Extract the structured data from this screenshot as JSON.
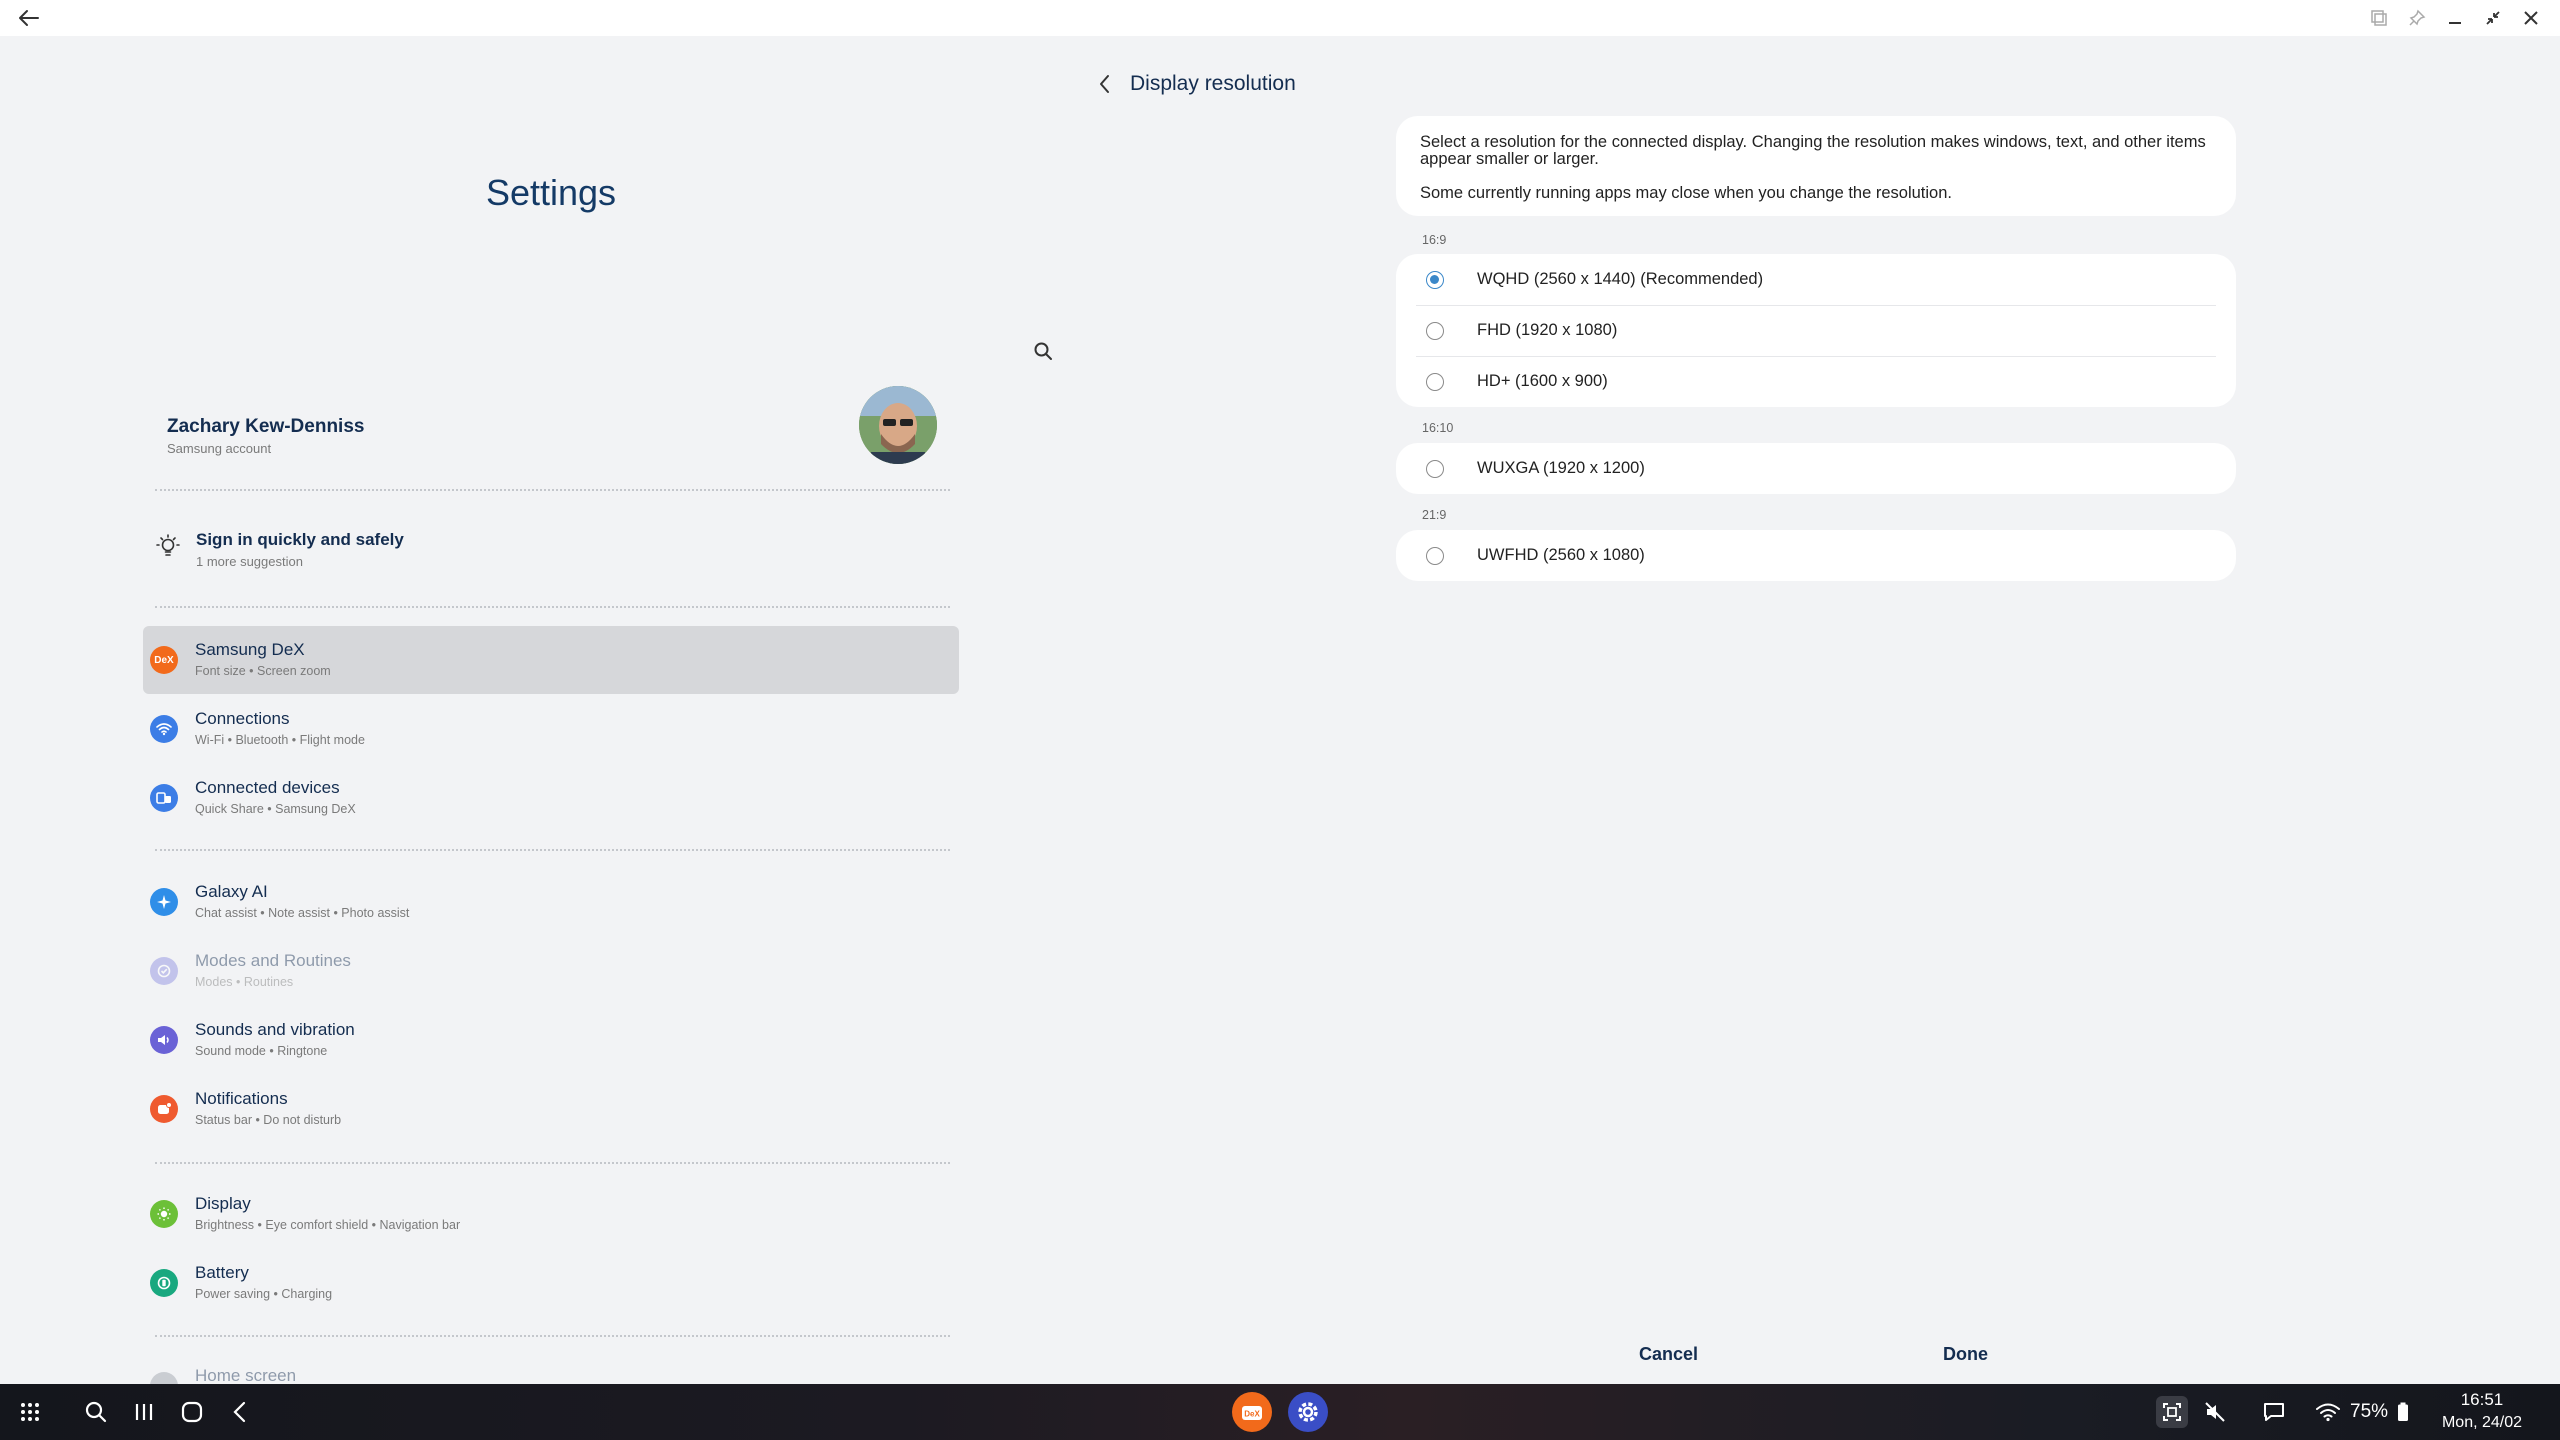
{
  "settings": {
    "title": "Settings",
    "account": {
      "name": "Zachary Kew-Denniss",
      "sub": "Samsung account"
    },
    "suggestion": {
      "title": "Sign in quickly and safely",
      "sub": "1 more suggestion"
    },
    "items": [
      {
        "title": "Samsung DeX",
        "sub": "Font size  •  Screen zoom",
        "icon_label": "DeX",
        "color": "#f26a1b"
      },
      {
        "title": "Connections",
        "sub": "Wi-Fi  •  Bluetooth  •  Flight mode",
        "color": "#3c7de6"
      },
      {
        "title": "Connected devices",
        "sub": "Quick Share  •  Samsung DeX",
        "color": "#3c7de6"
      },
      {
        "title": "Galaxy AI",
        "sub": "Chat assist  •  Note assist  •  Photo assist",
        "color": "#2f8ee8"
      },
      {
        "title": "Modes and Routines",
        "sub": "Modes  •  Routines",
        "color": "#8a8ae0"
      },
      {
        "title": "Sounds and vibration",
        "sub": "Sound mode  •  Ringtone",
        "color": "#6a62d6"
      },
      {
        "title": "Notifications",
        "sub": "Status bar  •  Do not disturb",
        "color": "#ef5a2f"
      },
      {
        "title": "Display",
        "sub": "Brightness  •  Eye comfort shield  •  Navigation bar",
        "color": "#6cc038"
      },
      {
        "title": "Battery",
        "sub": "Power saving  •  Charging",
        "color": "#19a87f"
      },
      {
        "title": "Home screen",
        "sub": "",
        "color": "#9aa0a8"
      }
    ]
  },
  "resolution": {
    "title": "Display resolution",
    "description_1": "Select a resolution for the connected display. Changing the resolution makes windows, text, and other items appear smaller or larger.",
    "description_2": "Some currently running apps may close when you change the resolution.",
    "groups": [
      {
        "label": "16:9",
        "options": [
          {
            "label": "WQHD (2560 x 1440) (Recommended)",
            "selected": true
          },
          {
            "label": "FHD (1920 x 1080)",
            "selected": false
          },
          {
            "label": "HD+ (1600 x 900)",
            "selected": false
          }
        ]
      },
      {
        "label": "16:10",
        "options": [
          {
            "label": "WUXGA (1920 x 1200)",
            "selected": false
          }
        ]
      },
      {
        "label": "21:9",
        "options": [
          {
            "label": "UWFHD (2560 x 1080)",
            "selected": false
          }
        ]
      }
    ],
    "cancel": "Cancel",
    "done": "Done"
  },
  "taskbar": {
    "battery": "75%",
    "time": "16:51",
    "date": "Mon, 24/02",
    "dex_app_label": "DeX"
  },
  "colors": {
    "accent": "#3b88c9",
    "title_text": "#142d50",
    "background": "#f2f3f5"
  }
}
